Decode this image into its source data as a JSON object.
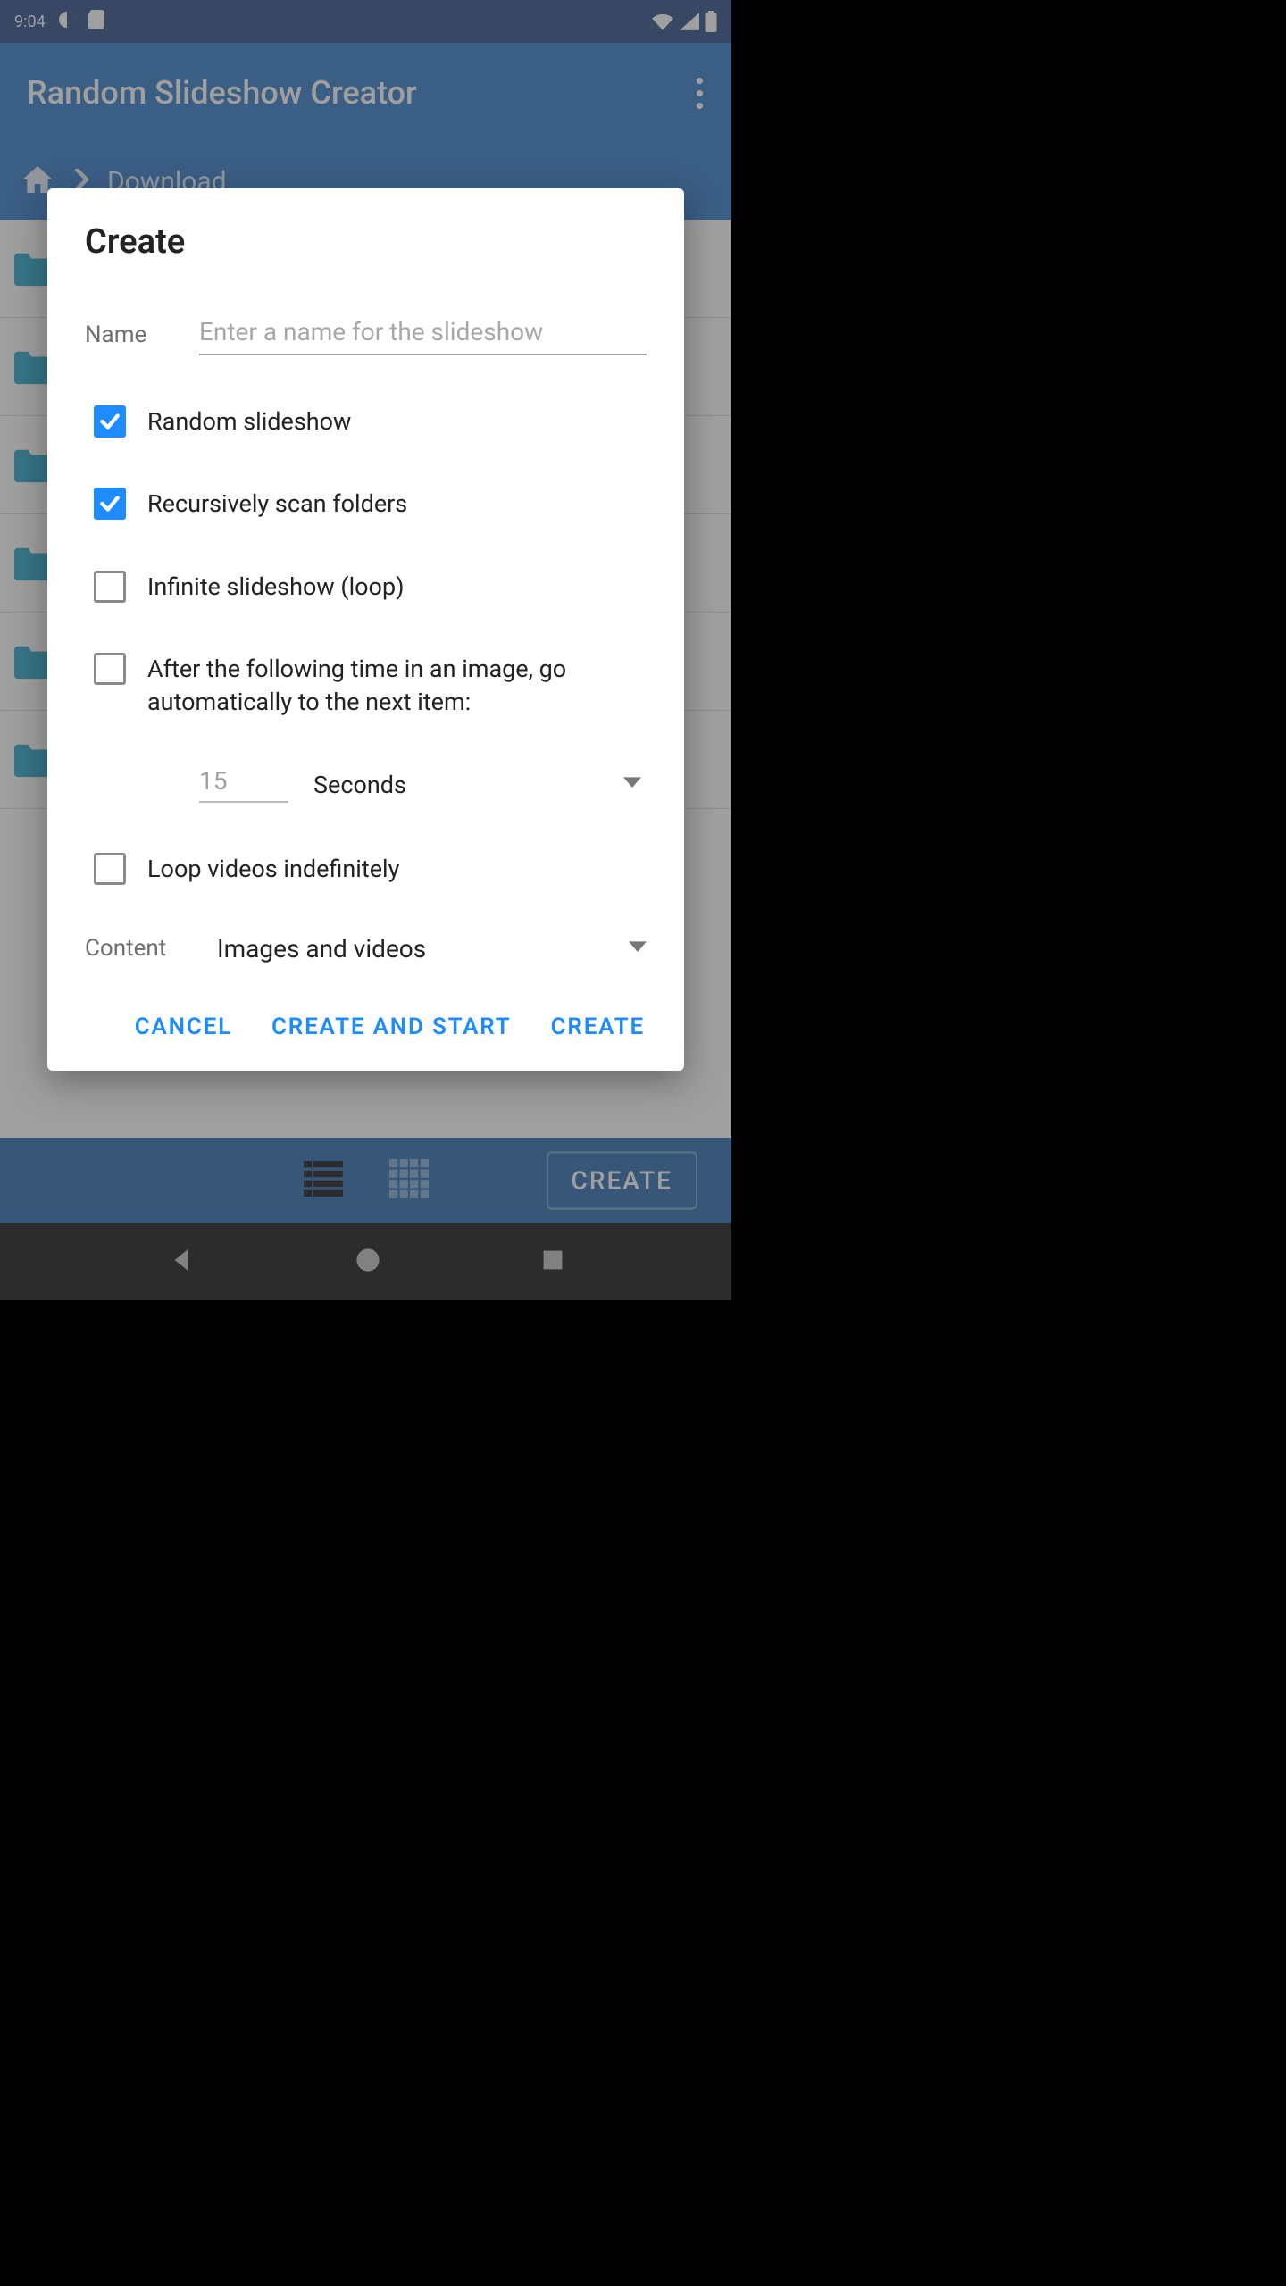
{
  "statusbar": {
    "time": "9:04"
  },
  "appbar": {
    "title": "Random Slideshow Creator"
  },
  "breadcrumb": {
    "current": "Download"
  },
  "bottombar": {
    "create_label": "CREATE"
  },
  "dialog": {
    "title": "Create",
    "name_label": "Name",
    "name_placeholder": "Enter a name for the slideshow",
    "name_value": "",
    "random_label": "Random slideshow",
    "random_checked": true,
    "recursive_label": "Recursively scan folders",
    "recursive_checked": true,
    "infinite_label": "Infinite slideshow (loop)",
    "infinite_checked": false,
    "autoadvance_label": "After the following time in an image, go automatically to the next item:",
    "autoadvance_checked": false,
    "time_value": "15",
    "time_unit": "Seconds",
    "loopvideos_label": "Loop videos indefinitely",
    "loopvideos_checked": false,
    "content_label": "Content",
    "content_value": "Images and videos",
    "actions": {
      "cancel": "CANCEL",
      "create_start": "CREATE AND START",
      "create": "CREATE"
    }
  }
}
